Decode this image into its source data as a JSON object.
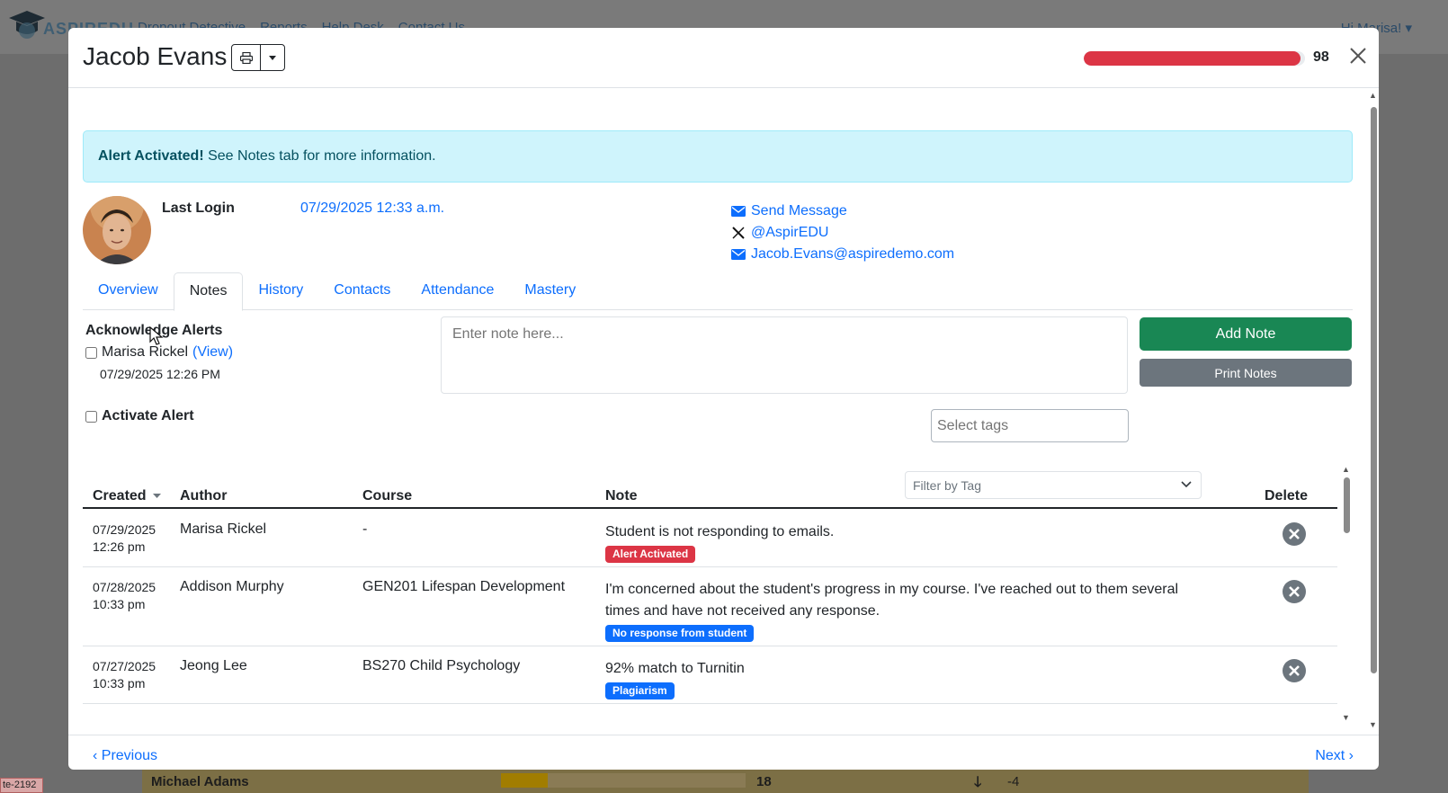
{
  "background": {
    "logo_text": "ASPIREDU",
    "nav_links": [
      "Dropout Detective",
      "Reports",
      "Help Desk",
      "Contact Us"
    ],
    "greeting": "Hi Marisa!",
    "row": {
      "name": "Michael Adams",
      "score": "18",
      "delta": "-4"
    },
    "corner_tag": "te-2192"
  },
  "modal": {
    "student_name": "Jacob Evans",
    "risk_score": "98",
    "risk_fraction": 0.98,
    "alert": {
      "strong": "Alert Activated!",
      "text": "See Notes tab for more information."
    },
    "last_login_label": "Last Login",
    "last_login_value": "07/29/2025 12:33 a.m.",
    "contacts": {
      "send_message": "Send Message",
      "x_handle": "@AspirEDU",
      "email": "Jacob.Evans@aspiredemo.com"
    },
    "tabs": [
      "Overview",
      "Notes",
      "History",
      "Contacts",
      "Attendance",
      "Mastery"
    ],
    "active_tab": "Notes",
    "ack": {
      "title": "Acknowledge Alerts",
      "name": "Marisa Rickel",
      "view": "(View)",
      "date": "07/29/2025 12:26 PM"
    },
    "activate_label": "Activate Alert",
    "note_placeholder": "Enter note here...",
    "add_note_label": "Add Note",
    "print_notes_label": "Print Notes",
    "tags_placeholder": "Select tags",
    "table": {
      "headers": {
        "created": "Created",
        "author": "Author",
        "course": "Course",
        "note": "Note",
        "delete": "Delete"
      },
      "filter_placeholder": "Filter by Tag",
      "rows": [
        {
          "date": "07/29/2025",
          "time": "12:26 pm",
          "author": "Marisa Rickel",
          "course": "-",
          "note": "Student is not responding to emails.",
          "tag": "Alert Activated",
          "tag_color": "#dc3545"
        },
        {
          "date": "07/28/2025",
          "time": "10:33 pm",
          "author": "Addison Murphy",
          "course": "GEN201 Lifespan Development",
          "note": "I'm concerned about the student's progress in my course. I've reached out to them several times and have not received any response.",
          "tag": "No response from student",
          "tag_color": "#0d6efd"
        },
        {
          "date": "07/27/2025",
          "time": "10:33 pm",
          "author": "Jeong Lee",
          "course": "BS270 Child Psychology",
          "note": "92% match to Turnitin",
          "tag": "Plagiarism",
          "tag_color": "#0d6efd"
        }
      ]
    },
    "footer": {
      "previous": "‹ Previous",
      "next": "Next ›"
    }
  },
  "colors": {
    "primary": "#0d6efd",
    "danger": "#dc3545",
    "success": "#198754",
    "secondary": "#6c757d",
    "info_bg": "#cff4fc"
  },
  "icons": [
    "print-icon",
    "caret-down-icon",
    "close-icon",
    "envelope-icon",
    "x-logo-icon",
    "sort-caret-icon",
    "chevron-down-icon",
    "delete-circle-icon"
  ]
}
